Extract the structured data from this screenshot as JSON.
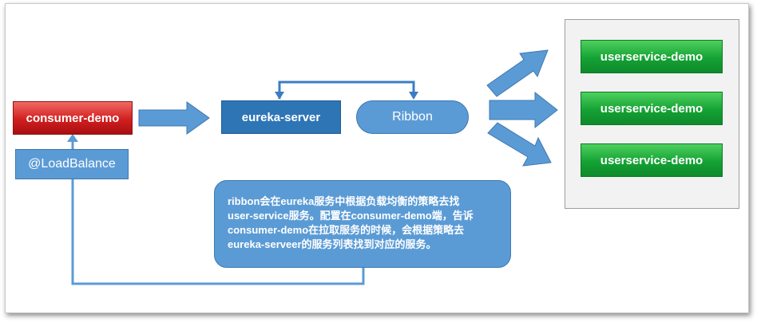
{
  "nodes": {
    "consumer": "consumer-demo",
    "load_balance": "@LoadBalance",
    "eureka": "eureka-server",
    "ribbon": "Ribbon"
  },
  "services": [
    "userservice-demo",
    "userservice-demo",
    "userservice-demo"
  ],
  "note": {
    "lines": [
      "ribbon会在eureka服务中根据负载均衡的策略去找",
      "user-service服务。配置在consumer-demo端，告诉",
      "consumer-demo在拉取服务的时候，会根据策略去",
      "eureka-serveer的服务列表找到对应的服务。"
    ]
  },
  "colors": {
    "consumer": "#d11f1f",
    "eureka": "#2e75b6",
    "light_blue": "#5b9bd5",
    "service_green": "#14a234"
  }
}
